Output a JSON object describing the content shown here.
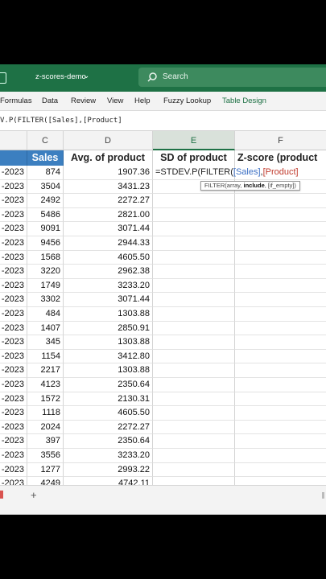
{
  "titlebar": {
    "document_name": "z-scores-demo",
    "search_placeholder": "Search",
    "accent_color": "#1e7145"
  },
  "ribbon": {
    "tabs": [
      "Formulas",
      "Data",
      "Review",
      "View",
      "Help",
      "Fuzzy Lookup",
      "Table Design"
    ]
  },
  "formula_bar": {
    "text": "V.P(FILTER([Sales],[Product]"
  },
  "columns": {
    "letters": [
      "C",
      "D",
      "E",
      "F"
    ],
    "selected": "E"
  },
  "table": {
    "headers": {
      "sales": "Sales",
      "avg": "Avg. of product",
      "sd": "SD of product",
      "z": "Z-score (product"
    },
    "rows": [
      {
        "a": "-2023",
        "c": "874",
        "d": "1907.36"
      },
      {
        "a": "-2023",
        "c": "3504",
        "d": "3431.23"
      },
      {
        "a": "-2023",
        "c": "2492",
        "d": "2272.27"
      },
      {
        "a": "-2023",
        "c": "5486",
        "d": "2821.00"
      },
      {
        "a": "-2023",
        "c": "9091",
        "d": "3071.44"
      },
      {
        "a": "-2023",
        "c": "9456",
        "d": "2944.33"
      },
      {
        "a": "-2023",
        "c": "1568",
        "d": "4605.50"
      },
      {
        "a": "-2023",
        "c": "3220",
        "d": "2962.38"
      },
      {
        "a": "-2023",
        "c": "1749",
        "d": "3233.20"
      },
      {
        "a": "-2023",
        "c": "3302",
        "d": "3071.44"
      },
      {
        "a": "-2023",
        "c": "484",
        "d": "1303.88"
      },
      {
        "a": "-2023",
        "c": "1407",
        "d": "2850.91"
      },
      {
        "a": "-2023",
        "c": "345",
        "d": "1303.88"
      },
      {
        "a": "-2023",
        "c": "1154",
        "d": "3412.80"
      },
      {
        "a": "-2023",
        "c": "2217",
        "d": "1303.88"
      },
      {
        "a": "-2023",
        "c": "4123",
        "d": "2350.64"
      },
      {
        "a": "-2023",
        "c": "1572",
        "d": "2130.31"
      },
      {
        "a": "-2023",
        "c": "1118",
        "d": "4605.50"
      },
      {
        "a": "-2023",
        "c": "2024",
        "d": "2272.27"
      },
      {
        "a": "-2023",
        "c": "397",
        "d": "2350.64"
      },
      {
        "a": "-2023",
        "c": "3556",
        "d": "3233.20"
      },
      {
        "a": "-2023",
        "c": "1277",
        "d": "2993.22"
      },
      {
        "a": "-2023",
        "c": "4249",
        "d": "4742.11"
      }
    ]
  },
  "active_cell": {
    "formula_prefix": "=STDEV.P(FILTER(",
    "ref_sales": "[Sales]",
    "separator": ",",
    "ref_product": "[Product]"
  },
  "tooltip": {
    "prefix": "FILTER(array, ",
    "bold": "include",
    "suffix": ", [if_empty])"
  }
}
